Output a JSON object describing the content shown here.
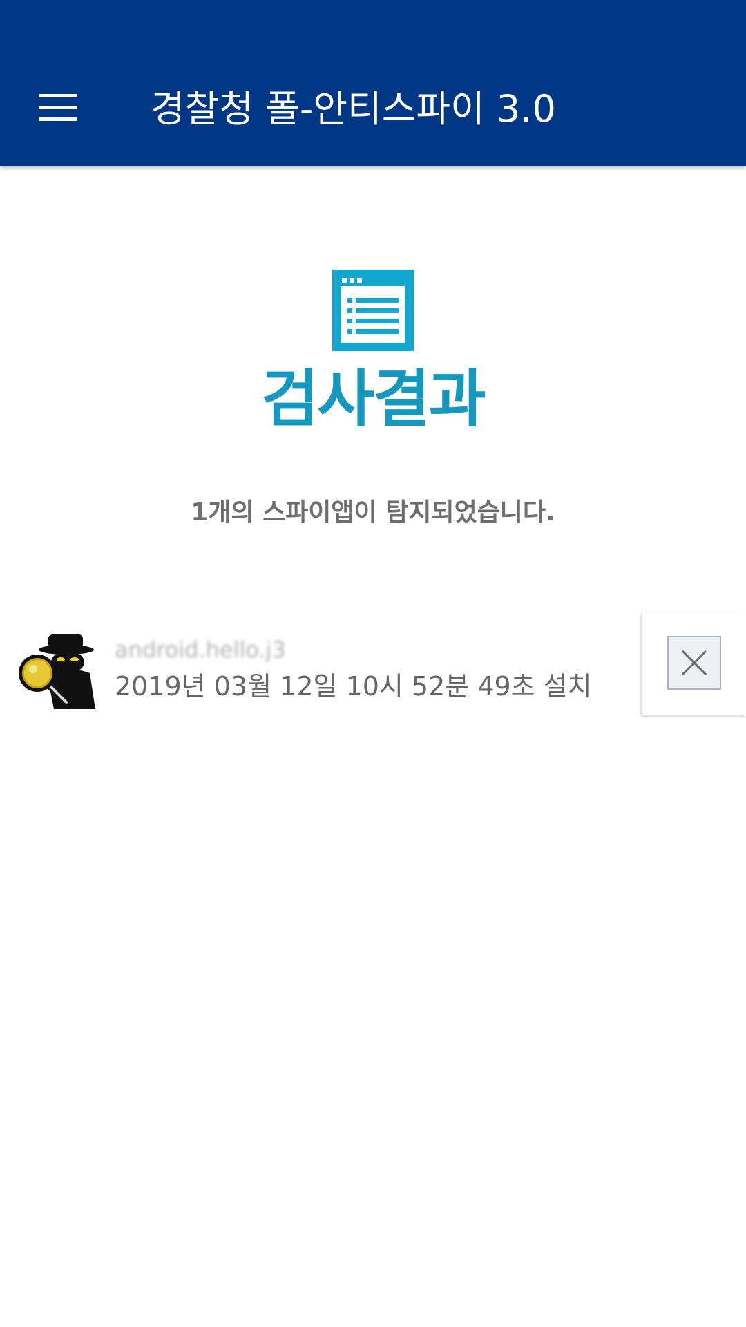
{
  "app_bar": {
    "title": "경찰청 폴-안티스파이 3.0",
    "background_color": "#003784",
    "menu_icon": "hamburger-menu-icon"
  },
  "result": {
    "icon": "document-list-icon",
    "icon_color": "#14a6cf",
    "heading": "검사결과",
    "heading_color": "#1597be",
    "summary": "1개의 스파이앱이 탐지되었습니다."
  },
  "detected_apps": [
    {
      "icon": "spy-detective-icon",
      "package_name": "android.hello.j3",
      "install_time": "2019년 03월 12일 10시 52분 49초 설치",
      "delete_icon": "close-icon"
    }
  ]
}
